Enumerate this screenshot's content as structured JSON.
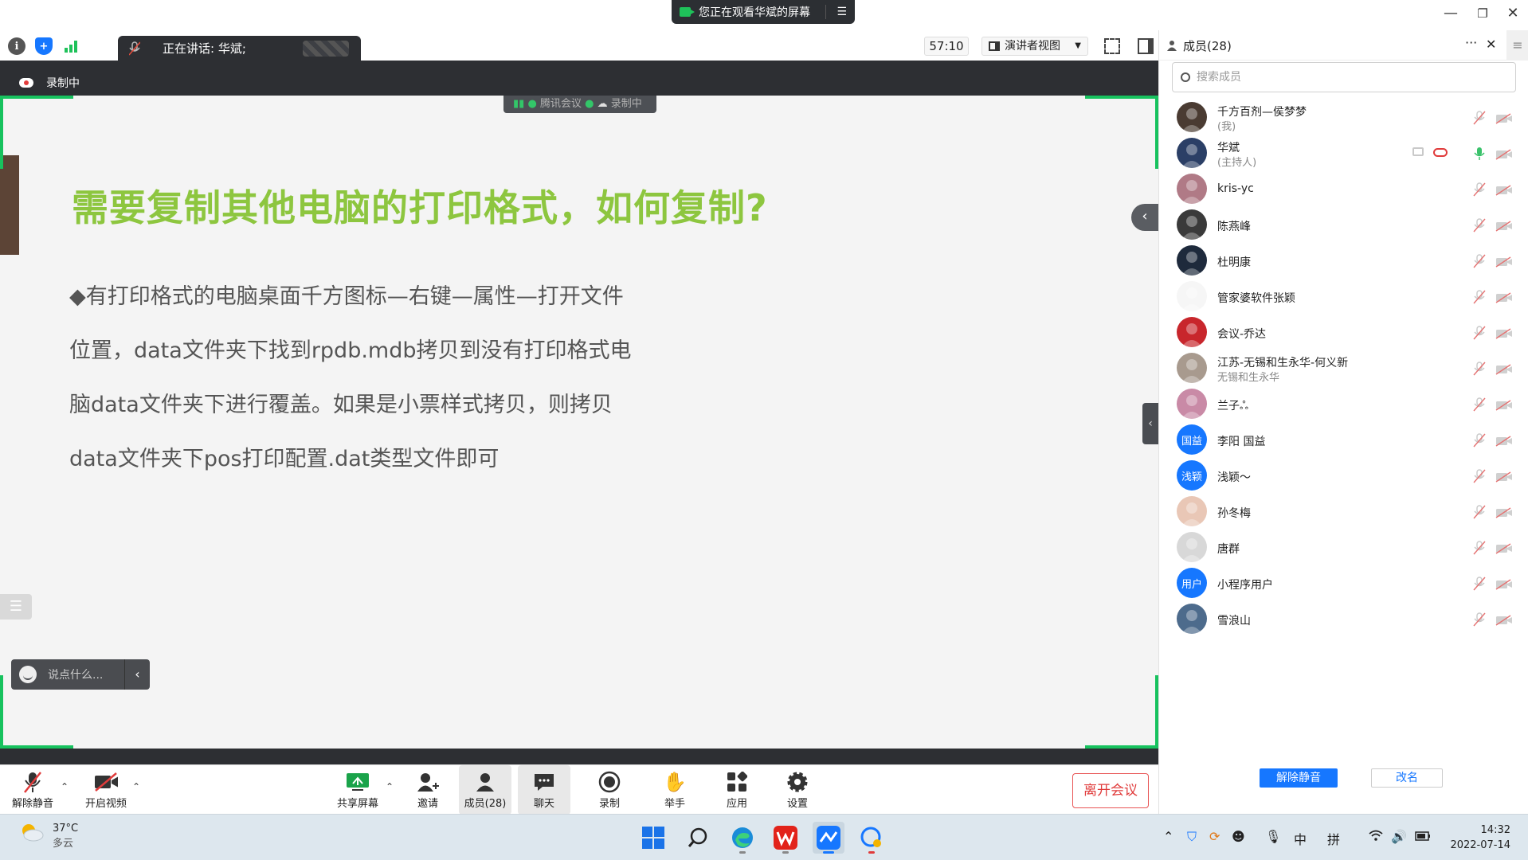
{
  "window": {
    "share_notice": "您正在观看华斌的屏幕",
    "controls": {
      "minimize": "—",
      "restore": "❐",
      "close": "✕"
    }
  },
  "topbar": {
    "speaking": "正在讲话: 华斌;",
    "timer": "57:10",
    "view_mode": "演讲者视图"
  },
  "stage": {
    "recording_label": "录制中",
    "badge_app": "腾讯会议",
    "badge_rec": "录制中",
    "chat_placeholder": "说点什么..."
  },
  "slide": {
    "title": "需要复制其他电脑的打印格式，如何复制?",
    "lines": [
      "◆有打印格式的电脑桌面千方图标—右键—属性—打开文件",
      "位置，data文件夹下找到rpdb.mdb拷贝到没有打印格式电",
      "脑data文件夹下进行覆盖。如果是小票样式拷贝，则拷贝",
      "data文件夹下pos打印配置.dat类型文件即可"
    ]
  },
  "controls": {
    "unmute": "解除静音",
    "video": "开启视频",
    "share": "共享屏幕",
    "invite": "邀请",
    "members": "成员(28)",
    "chat": "聊天",
    "record": "录制",
    "raise_hand": "举手",
    "apps": "应用",
    "settings": "设置",
    "leave": "离开会议"
  },
  "panel": {
    "title": "成员(28)",
    "more": "···",
    "close": "✕",
    "search_placeholder": "搜索成员",
    "members": [
      {
        "name": "千方百剂—侯梦梦",
        "sub": "(我)",
        "avatar": "photo",
        "color": "#4a3b32"
      },
      {
        "name": "华斌",
        "sub": "(主持人)",
        "avatar": "photo",
        "color": "#2b3f66",
        "host": true
      },
      {
        "name": "kris-yc",
        "sub": "",
        "avatar": "photo",
        "color": "#b07a86"
      },
      {
        "name": "陈燕峰",
        "sub": "",
        "avatar": "photo",
        "color": "#3a3a3a"
      },
      {
        "name": "杜明康",
        "sub": "",
        "avatar": "photo",
        "color": "#1e2a3c"
      },
      {
        "name": "管家婆软件张颖",
        "sub": "",
        "avatar": "photo",
        "color": "#f6f6f6"
      },
      {
        "name": "会议-乔达",
        "sub": "",
        "avatar": "photo",
        "color": "#c8262c"
      },
      {
        "name": "江苏-无锡和生永华-何义新",
        "sub": "无锡和生永华",
        "avatar": "photo",
        "color": "#a89a8e"
      },
      {
        "name": "兰子ஃ",
        "sub": "",
        "avatar": "photo",
        "color": "#c98aa6"
      },
      {
        "name": "李阳 国益",
        "sub": "",
        "avatar": "text",
        "initials": "国益",
        "color": "#1677ff"
      },
      {
        "name": "浅颖～",
        "sub": "",
        "avatar": "text",
        "initials": "浅颖",
        "color": "#1677ff"
      },
      {
        "name": "孙冬梅",
        "sub": "",
        "avatar": "photo",
        "color": "#e9c7b6"
      },
      {
        "name": "唐群",
        "sub": "",
        "avatar": "photo",
        "color": "#d8d8d8"
      },
      {
        "name": "小程序用户",
        "sub": "",
        "avatar": "text",
        "initials": "用户",
        "color": "#1677ff"
      },
      {
        "name": "雪浪山",
        "sub": "",
        "avatar": "photo",
        "color": "#4d6b8c"
      }
    ],
    "unmute_all": "解除静音",
    "rename": "改名"
  },
  "taskbar": {
    "temp": "37°C",
    "weather": "多云",
    "ime_lang": "中",
    "ime_mode": "拼",
    "time": "14:32",
    "date": "2022-07-14"
  },
  "colors": {
    "accent": "#1677ff",
    "title_green": "#8dc63f",
    "frame_green": "#17c25e",
    "leave_red": "#e03b3b"
  }
}
